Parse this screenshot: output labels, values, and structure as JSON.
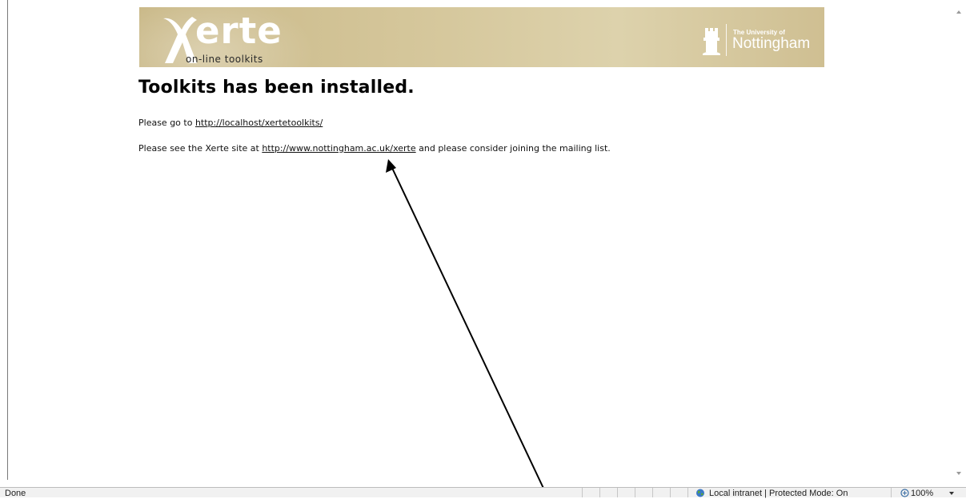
{
  "banner": {
    "logo_word": "erte",
    "logo_tagline": "on-line toolkits",
    "university_small": "The University of",
    "university_name": "Nottingham"
  },
  "content": {
    "heading": "Toolkits has been installed.",
    "para1_prefix": "Please go to ",
    "para1_link": "http://localhost/xertetoolkits/",
    "para2_prefix": "Please see the Xerte site at ",
    "para2_link": "http://www.nottingham.ac.uk/xerte",
    "para2_suffix": " and please consider joining the mailing list."
  },
  "statusbar": {
    "status": "Done",
    "zone": "Local intranet | Protected Mode: On",
    "zoom": "100%"
  },
  "icons": [
    "xerte-x-logo-icon",
    "nottingham-crest-icon",
    "globe-icon",
    "zoom-icon",
    "chevron-down-icon",
    "scroll-up-arrow-icon",
    "scroll-down-arrow-icon"
  ]
}
